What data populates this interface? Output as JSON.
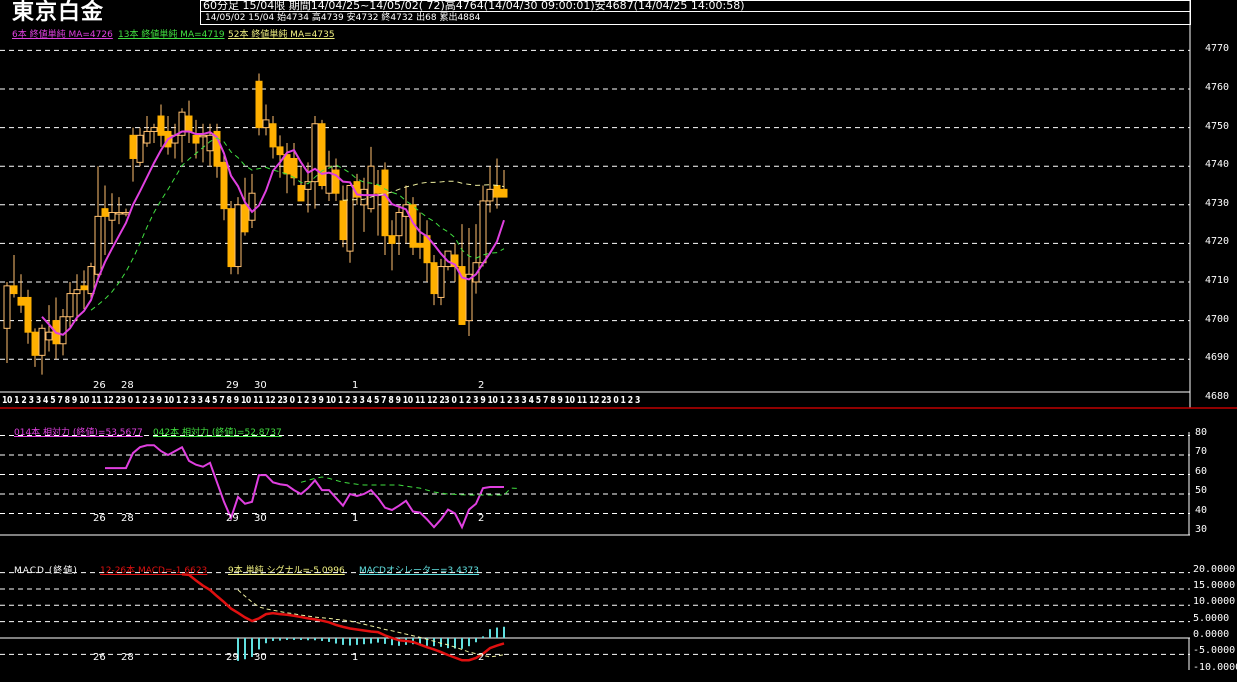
{
  "header": {
    "title": "東京白金",
    "line1": "60分足 15/04限 期間14/04/25~14/05/02( 72)高4764(14/04/30 09:00:01)安4687(14/04/25 14:00:58)",
    "line2": "14/05/02 15/04 始4734 高4739 安4732 終4732 出68 累出4884"
  },
  "legends": {
    "ma6": "6本 終値単純 MA=4726",
    "ma13": "13本 終値単純 MA=4719",
    "ma52": "52本 終値単純 MA=4735",
    "rsi14": "014本 相対力 (終値)=53.5677",
    "rsi42": "042本 相対力 (終値)=52.8737",
    "macd_title": "MACD (終値)",
    "macd": "12-26本 MACD=-1.6623",
    "signal": "9本 単純 シグナル=-5.0996",
    "osc": "MACDオシレーター=3.4373"
  },
  "colors": {
    "candle": "#ffb000",
    "ma6": "#e040e0",
    "ma13": "#40e040",
    "ma52": "#f0f0a0",
    "rsi14": "#e040e0",
    "rsi42": "#40e040",
    "macd": "#e01010",
    "signal": "#f0f0a0",
    "hist": "#60e0e0",
    "separator": "#c00000"
  },
  "day_labels": [
    {
      "label": "26",
      "bar": 13
    },
    {
      "label": "28",
      "bar": 17
    },
    {
      "label": "29",
      "bar": 32
    },
    {
      "label": "30",
      "bar": 36
    },
    {
      "label": "1",
      "bar": 50
    },
    {
      "label": "2",
      "bar": 68
    }
  ],
  "hour_axis": "10 1 2 3 3 4 5 7 8 9 10 11 12 23 0 1 2 3 9 10 1 2 3 3 4 5 7 8 9 10 11 12 23 0 1 2 3 9 10 1 2 3 3 4 5 7 8 9 10 11 12 23 0 1 2 3 9 10 1 2 3 3 4 5 7 8 9 10 11 12 23 0 1 2 3",
  "chart_data": [
    {
      "type": "candlestick",
      "title": "東京白金 60分足",
      "ylim": [
        4680,
        4770
      ],
      "yticks": [
        "4770",
        "4760",
        "4750",
        "4740",
        "4730",
        "4720",
        "4710",
        "4700",
        "4690",
        "4680"
      ],
      "ohlc": [
        [
          4698,
          4710,
          4689,
          4709
        ],
        [
          4709,
          4717,
          4706,
          4707
        ],
        [
          4706,
          4712,
          4702,
          4704
        ],
        [
          4706,
          4708,
          4694,
          4697
        ],
        [
          4697,
          4698,
          4688,
          4691
        ],
        [
          4691,
          4699,
          4686,
          4698
        ],
        [
          4695,
          4704,
          4692,
          4697
        ],
        [
          4700,
          4706,
          4690,
          4694
        ],
        [
          4694,
          4703,
          4691,
          4701
        ],
        [
          4701,
          4710,
          4698,
          4707
        ],
        [
          4707,
          4712,
          4700,
          4708
        ],
        [
          4709,
          4713,
          4703,
          4708
        ],
        [
          4707,
          4715,
          4705,
          4714
        ],
        [
          4712,
          4740,
          4710,
          4727
        ],
        [
          4729,
          4735,
          4717,
          4727
        ],
        [
          4726,
          4733,
          4720,
          4728
        ],
        [
          4728,
          4732,
          4725,
          4728
        ],
        [
          4728,
          4729,
          4727,
          4728
        ],
        [
          4748,
          4750,
          4736,
          4742
        ],
        [
          4741,
          4750,
          4740,
          4748
        ],
        [
          4746,
          4753,
          4745,
          4749
        ],
        [
          4749,
          4751,
          4746,
          4750
        ],
        [
          4753,
          4756,
          4745,
          4748
        ],
        [
          4749,
          4753,
          4743,
          4745
        ],
        [
          4746,
          4751,
          4742,
          4748
        ],
        [
          4748,
          4755,
          4741,
          4754
        ],
        [
          4753,
          4757,
          4746,
          4749
        ],
        [
          4748,
          4752,
          4742,
          4746
        ],
        [
          4748,
          4751,
          4741,
          4748
        ],
        [
          4744,
          4751,
          4740,
          4748
        ],
        [
          4749,
          4751,
          4737,
          4740
        ],
        [
          4741,
          4743,
          4726,
          4729
        ],
        [
          4729,
          4731,
          4712,
          4714
        ],
        [
          4714,
          4732,
          4712,
          4730
        ],
        [
          4730,
          4737,
          4722,
          4723
        ],
        [
          4726,
          4738,
          4724,
          4733
        ],
        [
          4762,
          4764,
          4748,
          4750
        ],
        [
          4750,
          4756,
          4748,
          4752
        ],
        [
          4751,
          4753,
          4742,
          4745
        ],
        [
          4745,
          4748,
          4737,
          4743
        ],
        [
          4743,
          4746,
          4733,
          4738
        ],
        [
          4742,
          4746,
          4735,
          4737
        ],
        [
          4735,
          4740,
          4731,
          4731
        ],
        [
          4734,
          4741,
          4728,
          4736
        ],
        [
          4736,
          4753,
          4729,
          4751
        ],
        [
          4751,
          4752,
          4734,
          4735
        ],
        [
          4733,
          4744,
          4731,
          4740
        ],
        [
          4739,
          4742,
          4731,
          4733
        ],
        [
          4731,
          4735,
          4719,
          4721
        ],
        [
          4718,
          4735,
          4715,
          4735
        ],
        [
          4736,
          4738,
          4730,
          4732
        ],
        [
          4730,
          4737,
          4723,
          4734
        ],
        [
          4729,
          4745,
          4728,
          4740
        ],
        [
          4735,
          4739,
          4722,
          4733
        ],
        [
          4739,
          4741,
          4717,
          4722
        ],
        [
          4722,
          4726,
          4713,
          4720
        ],
        [
          4722,
          4730,
          4717,
          4728
        ],
        [
          4727,
          4735,
          4720,
          4730
        ],
        [
          4730,
          4732,
          4717,
          4719
        ],
        [
          4720,
          4728,
          4716,
          4719
        ],
        [
          4722,
          4726,
          4710,
          4715
        ],
        [
          4715,
          4717,
          4704,
          4707
        ],
        [
          4706,
          4716,
          4704,
          4714
        ],
        [
          4714,
          4718,
          4713,
          4718
        ],
        [
          4717,
          4720,
          4710,
          4714
        ],
        [
          4714,
          4725,
          4699,
          4699
        ],
        [
          4700,
          4724,
          4696,
          4712
        ],
        [
          4710,
          4725,
          4707,
          4715
        ],
        [
          4715,
          4735,
          4714,
          4731
        ],
        [
          4731,
          4740,
          4728,
          4734
        ],
        [
          4735,
          4742,
          4729,
          4732
        ],
        [
          4734,
          4739,
          4732,
          4732
        ]
      ],
      "ma_periods": [
        6,
        13,
        52
      ]
    },
    {
      "type": "line",
      "title": "相対力",
      "ylim": [
        30,
        80
      ],
      "yticks": [
        "80",
        "70",
        "60",
        "50",
        "40",
        "30"
      ],
      "rsi14_start": 14,
      "rsi14": [
        63.3,
        63.3,
        63.3,
        63.3,
        71,
        74,
        75,
        75,
        72,
        70,
        72,
        74,
        67,
        65,
        64,
        66,
        56,
        46,
        37.7,
        48.5,
        45,
        46,
        59.7,
        59.7,
        56,
        55,
        54.5,
        52,
        50,
        53,
        57,
        52,
        52,
        48,
        44,
        50,
        49,
        50,
        52,
        48,
        43,
        41.8,
        44,
        46.5,
        41,
        40.5,
        37,
        33,
        37,
        42,
        40,
        33,
        42,
        45,
        53,
        53.6,
        53.6,
        53.57
      ],
      "rsi42_start": 42,
      "rsi42": [
        56,
        57,
        58,
        58.7,
        58,
        57,
        56,
        55.5,
        55,
        54.6,
        54.6,
        54.6,
        54.6,
        54.6,
        54.6,
        54,
        53.5,
        53,
        52,
        51,
        50.5,
        50,
        49.8,
        49.6,
        49.5,
        49.5,
        49.5,
        49.5,
        49.5,
        49.5,
        53,
        52.87
      ]
    },
    {
      "type": "line",
      "title": "MACD",
      "ylim": [
        -10,
        20
      ],
      "yticks": [
        "20.0000",
        "15.0000",
        "10.0000",
        "5.0000",
        "0.0000",
        "-5.0000",
        "-10.0000"
      ],
      "macd_start": 25,
      "macd": [
        19.5,
        19.3,
        17.6,
        16,
        14.7,
        12.8,
        11,
        9,
        7.7,
        6.3,
        5.2,
        6,
        7.3,
        7.6,
        7.3,
        7.1,
        6.8,
        6.4,
        6,
        5.7,
        5.3,
        4.8,
        4,
        3.4,
        2.9,
        2.6,
        2.3,
        2,
        1.8,
        0.8,
        0,
        -0.7,
        -0.9,
        -1.2,
        -2,
        -2.8,
        -3.5,
        -4.3,
        -5.2,
        -6,
        -6.8,
        -6.8,
        -6.1,
        -4.8,
        -3.1,
        -2.3,
        -1.66
      ],
      "signal_start": 33,
      "signal": [
        14.7,
        12.8,
        11,
        9.5,
        8.9,
        8.5,
        8.1,
        7.7,
        7.4,
        7,
        6.7,
        6.4,
        6.2,
        6,
        5.7,
        5.5,
        5.2,
        4.7,
        4.2,
        3.7,
        3.2,
        2.6,
        2.2,
        1.7,
        1.2,
        0.7,
        0.2,
        -0.4,
        -1,
        -1.6,
        -2.1,
        -2.8,
        -3.5,
        -4.3,
        -4.8,
        -5.3,
        -5.8,
        -5.5,
        -5.1
      ]
    }
  ]
}
